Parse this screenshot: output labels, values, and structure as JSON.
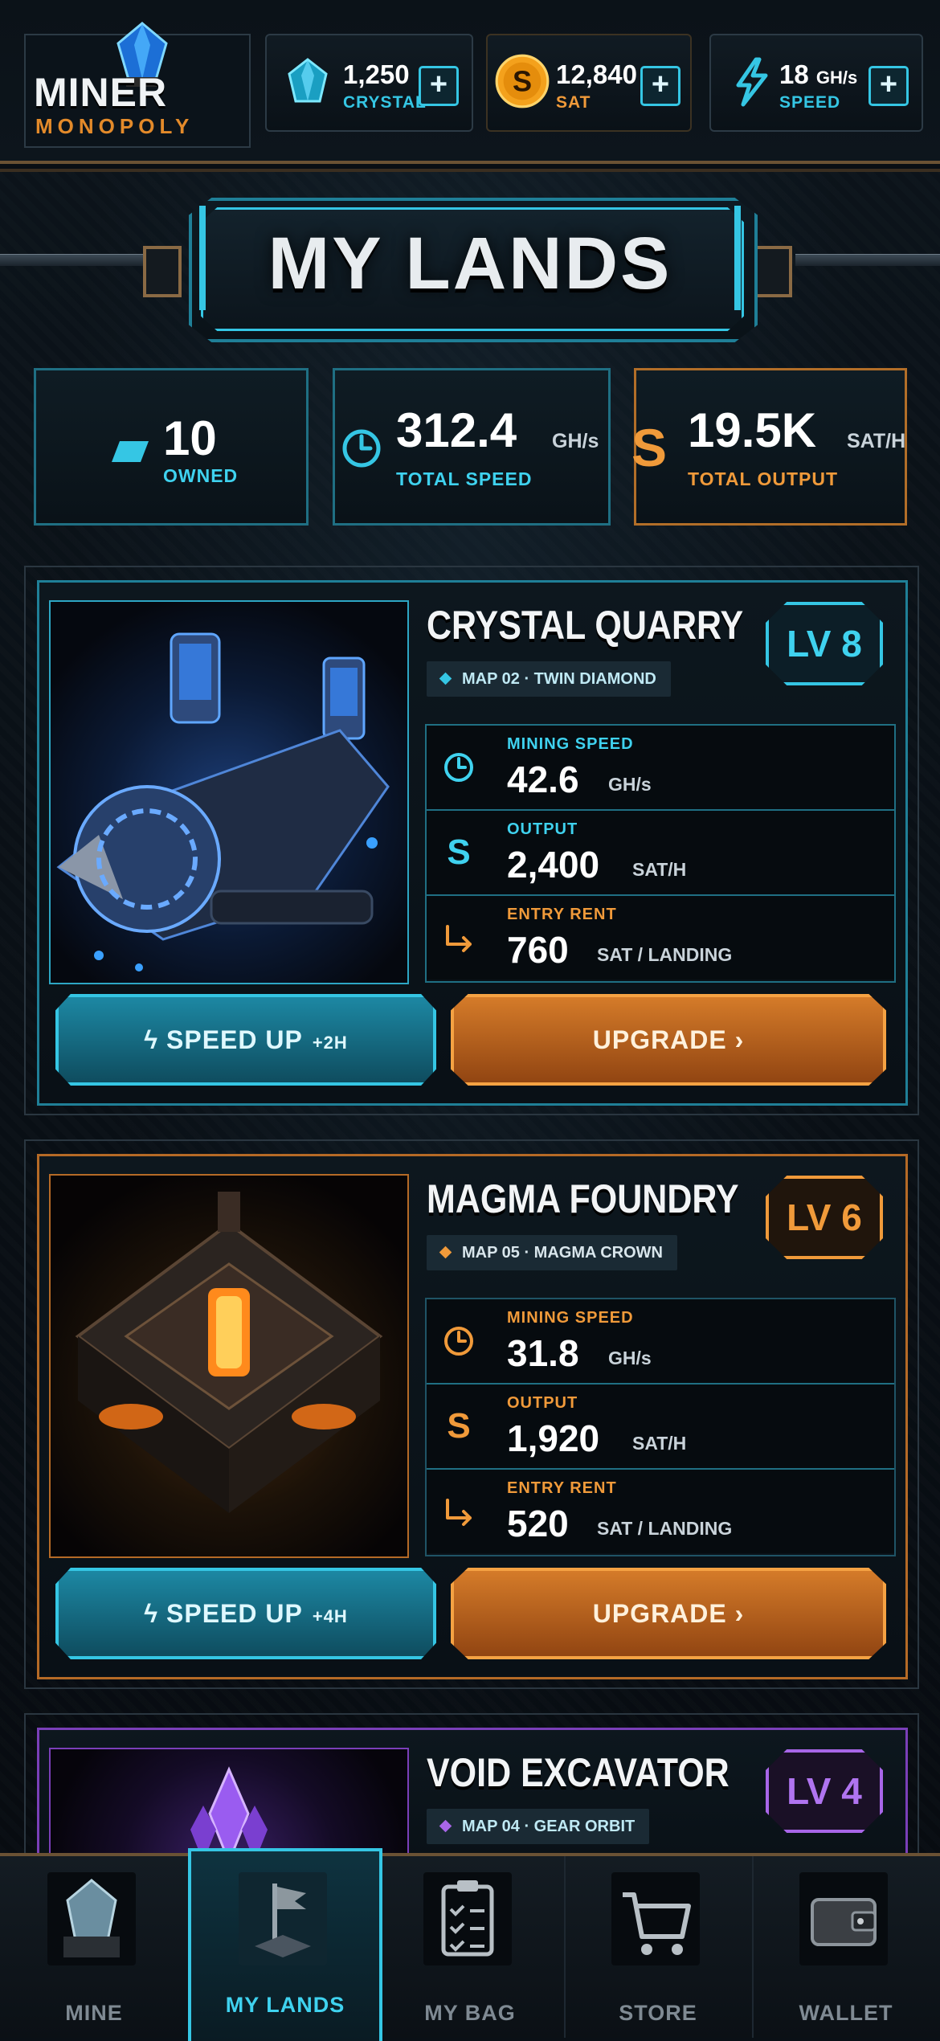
{
  "header": {
    "logo_main": "MINER",
    "logo_sub": "MONOPOLY",
    "resources": [
      {
        "value": "1,250",
        "label": "CRYSTAL",
        "icon": "crystal-icon",
        "color": "#35c6e4"
      },
      {
        "value": "12,840",
        "label": "SAT",
        "icon": "sat-coin-icon",
        "color": "#f0a020"
      },
      {
        "value": "18",
        "unit": "GH/s",
        "label": "SPEED",
        "icon": "lightning-icon",
        "color": "#35c6e4"
      }
    ],
    "plus_label": "+"
  },
  "title": "MY LANDS",
  "summary": {
    "owned": {
      "value": "10",
      "label": "OWNED"
    },
    "speed": {
      "value": "312.4",
      "unit": "GH/s",
      "label": "TOTAL SPEED"
    },
    "output": {
      "value": "19.5K",
      "unit": "SAT/H",
      "label": "TOTAL OUTPUT"
    }
  },
  "lands": [
    {
      "name": "CRYSTAL QUARRY",
      "tag": "MAP 02 · TWIN DIAMOND",
      "level": "LV 8",
      "mining_label": "MINING SPEED",
      "mining_value": "42.6",
      "mining_unit": "GH/s",
      "output_label": "OUTPUT",
      "output_value": "2,400",
      "output_unit": "SAT/H",
      "rent_label": "ENTRY RENT",
      "rent_value": "760",
      "rent_unit": "SAT / LANDING",
      "speed_button": "SPEED UP",
      "speed_bonus": "+2H",
      "upgrade_button": "UPGRADE ›"
    },
    {
      "name": "MAGMA FOUNDRY",
      "tag": "MAP 05 · MAGMA CROWN",
      "level": "LV 6",
      "mining_label": "MINING SPEED",
      "mining_value": "31.8",
      "mining_unit": "GH/s",
      "output_label": "OUTPUT",
      "output_value": "1,920",
      "output_unit": "SAT/H",
      "rent_label": "ENTRY RENT",
      "rent_value": "520",
      "rent_unit": "SAT / LANDING",
      "speed_button": "SPEED UP",
      "speed_bonus": "+4H",
      "upgrade_button": "UPGRADE ›"
    },
    {
      "name": "VOID EXCAVATOR",
      "tag": "MAP 04 · GEAR ORBIT",
      "level": "LV 4"
    }
  ],
  "nav": [
    {
      "label": "MINE",
      "icon": "mine-icon"
    },
    {
      "label": "MY LANDS",
      "icon": "flag-icon",
      "active": true
    },
    {
      "label": "MY BAG",
      "icon": "clipboard-icon"
    },
    {
      "label": "STORE",
      "icon": "cart-icon"
    },
    {
      "label": "WALLET",
      "icon": "wallet-icon"
    }
  ]
}
